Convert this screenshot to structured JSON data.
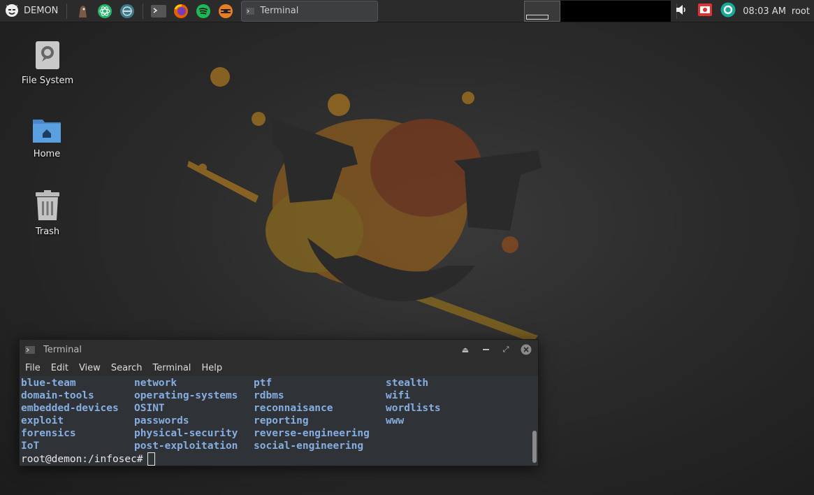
{
  "panel": {
    "menu_label": "DEMON",
    "launchers": [
      "beef-icon",
      "atom-icon",
      "eclipse-icon",
      "terminal-icon",
      "firefox-icon",
      "spotify-icon",
      "burpsuite-icon"
    ],
    "task_label": "Terminal",
    "clock": "08:03 AM",
    "user": "root",
    "tray_icons": [
      "volume-icon",
      "screen-recorder-icon",
      "camera-shutter-icon"
    ]
  },
  "desktop": {
    "icons": [
      {
        "label": "File System",
        "icon": "hard-drive-icon"
      },
      {
        "label": "Home",
        "icon": "home-folder-icon"
      },
      {
        "label": "Trash",
        "icon": "trash-icon"
      }
    ]
  },
  "terminal": {
    "title": "Terminal",
    "menu": [
      "File",
      "Edit",
      "View",
      "Search",
      "Terminal",
      "Help"
    ],
    "listing": [
      [
        "blue-team",
        "network",
        "ptf",
        "stealth"
      ],
      [
        "domain-tools",
        "operating-systems",
        "rdbms",
        "wifi"
      ],
      [
        "embedded-devices",
        "OSINT",
        "reconnaisance",
        "wordlists"
      ],
      [
        "exploit",
        "passwords",
        "reporting",
        "www"
      ],
      [
        "forensics",
        "physical-security",
        "reverse-engineering",
        ""
      ],
      [
        "IoT",
        "post-exploitation",
        "social-engineering",
        ""
      ]
    ],
    "prompt": "root@demon:/infosec#",
    "listing_color": "#86aee0"
  },
  "colors": {
    "panel_bg": "#2b2b2b",
    "accent_orange": "#c4761b",
    "accent_green": "#25c168",
    "accent_teal": "#1aa89a"
  }
}
